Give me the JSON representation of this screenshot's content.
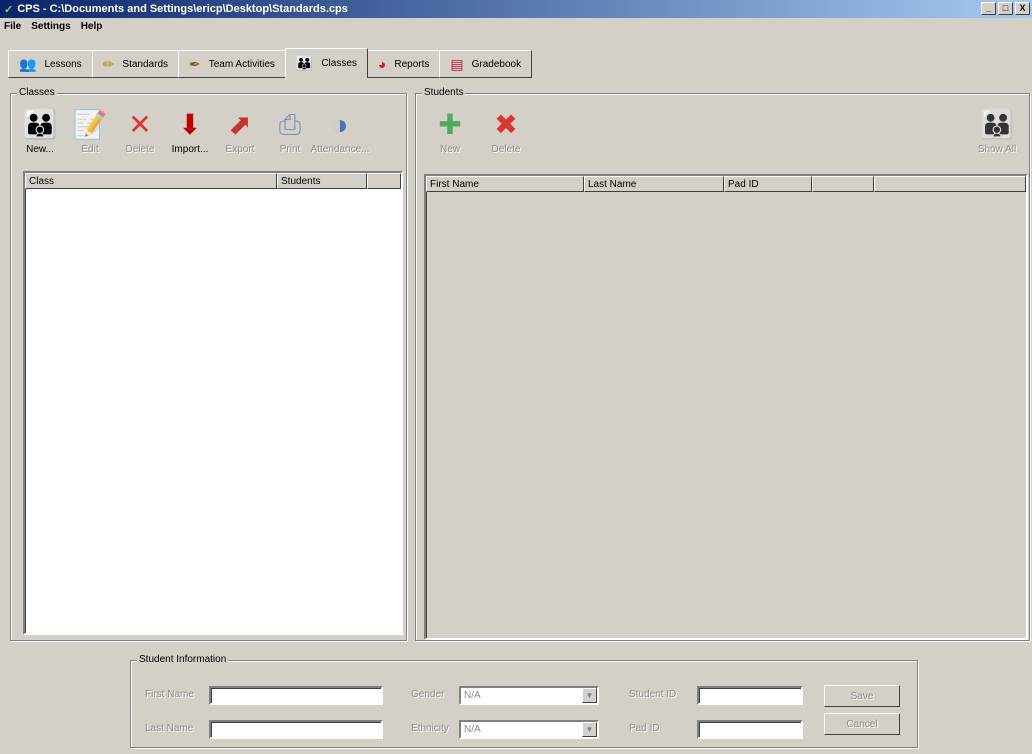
{
  "window": {
    "title": "CPS - C:\\Documents and Settings\\ericp\\Desktop\\Standards.cps",
    "minimize": "_",
    "maximize": "□",
    "close": "X"
  },
  "menu": [
    "File",
    "Settings",
    "Help"
  ],
  "tabs": [
    {
      "label": "Lessons",
      "icon": "lessons-icon",
      "glyph": "👥"
    },
    {
      "label": "Standards",
      "icon": "pencil-icon",
      "glyph": "✏"
    },
    {
      "label": "Team Activities",
      "icon": "brush-icon",
      "glyph": "✒"
    },
    {
      "label": "Classes",
      "icon": "people-icon",
      "glyph": "👪"
    },
    {
      "label": "Reports",
      "icon": "chart-icon",
      "glyph": "◕"
    },
    {
      "label": "Gradebook",
      "icon": "gradebook-icon",
      "glyph": "▤"
    }
  ],
  "active_tab": "Classes",
  "classes": {
    "group_label": "Classes",
    "toolbar": [
      {
        "label": "New...",
        "icon": "new-class-icon",
        "glyph": "👪",
        "color": "#2e7d32",
        "enabled": true
      },
      {
        "label": "Edit",
        "icon": "edit-icon",
        "glyph": "📝",
        "color": "#c8a000",
        "enabled": false
      },
      {
        "label": "Delete",
        "icon": "delete-x-icon",
        "glyph": "✕",
        "color": "#e00000",
        "enabled": false
      },
      {
        "label": "Import...",
        "icon": "import-icon",
        "glyph": "⬇",
        "color": "#c00000",
        "enabled": true
      },
      {
        "label": "Export",
        "icon": "export-icon",
        "glyph": "⬈",
        "color": "#c00000",
        "enabled": false
      },
      {
        "label": "Print",
        "icon": "printer-icon",
        "glyph": "⎙",
        "color": "#5a7fb0",
        "enabled": false
      },
      {
        "label": "Attendance...",
        "icon": "attendance-icon",
        "glyph": "◑",
        "color": "#2050b0",
        "enabled": false
      }
    ],
    "columns": [
      "Class",
      "Students"
    ]
  },
  "students": {
    "group_label": "Students",
    "toolbar": [
      {
        "label": "New",
        "icon": "new-student-icon",
        "glyph": "✚",
        "color": "#2a9d3a",
        "enabled": false
      },
      {
        "label": "Delete",
        "icon": "delete-student-icon",
        "glyph": "✖",
        "color": "#e00000",
        "enabled": false
      }
    ],
    "show_all": {
      "label": "Show All",
      "icon": "show-all-icon",
      "glyph": "👪"
    },
    "columns": [
      "First Name",
      "Last Name",
      "Pad ID"
    ]
  },
  "student_info": {
    "group_label": "Student Information",
    "first_name_label": "First Name",
    "last_name_label": "Last Name",
    "gender_label": "Gender",
    "gender_value": "N/A",
    "ethnicity_label": "Ethnicity",
    "ethnicity_value": "N/A",
    "student_id_label": "Student ID",
    "pad_id_label": "Pad ID",
    "save_label": "Save",
    "cancel_label": "Cancel"
  }
}
